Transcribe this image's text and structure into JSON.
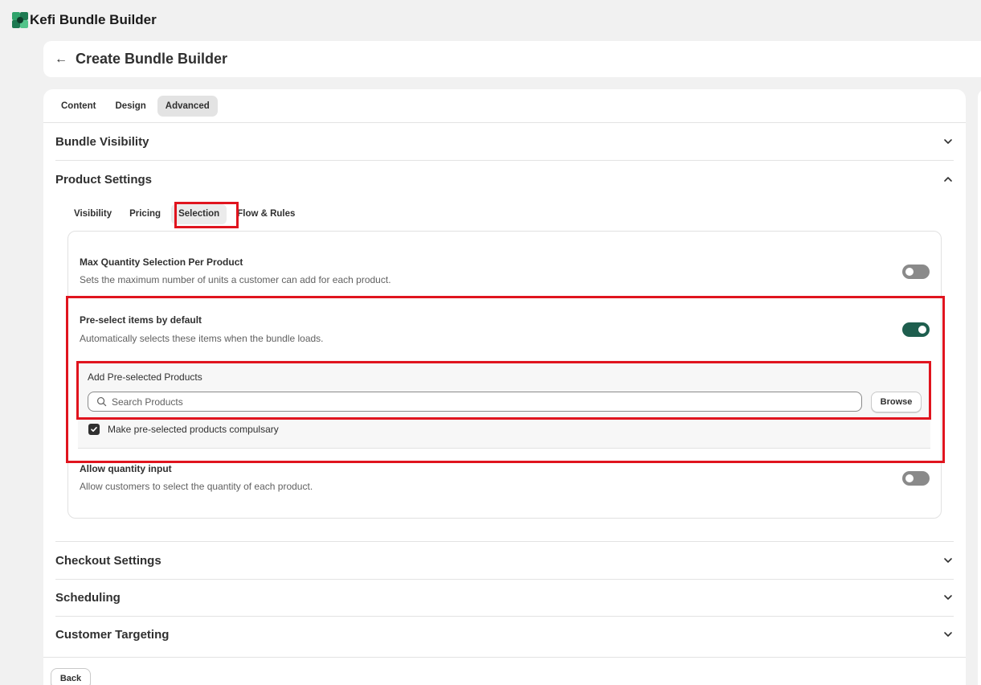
{
  "app": {
    "title": "Kefi Bundle Builder"
  },
  "header": {
    "page_title": "Create Bundle Builder"
  },
  "tabs": [
    {
      "label": "Content",
      "active": false
    },
    {
      "label": "Design",
      "active": false
    },
    {
      "label": "Advanced",
      "active": true
    }
  ],
  "sections": {
    "bundle_visibility": {
      "title": "Bundle Visibility",
      "expanded": false
    },
    "product_settings": {
      "title": "Product Settings",
      "expanded": true
    },
    "checkout_settings": {
      "title": "Checkout Settings",
      "expanded": false
    },
    "scheduling": {
      "title": "Scheduling",
      "expanded": false
    },
    "customer_targeting": {
      "title": "Customer Targeting",
      "expanded": false
    }
  },
  "product_tabs": [
    {
      "label": "Visibility",
      "active": false
    },
    {
      "label": "Pricing",
      "active": false
    },
    {
      "label": "Selection",
      "active": true
    },
    {
      "label": "Flow & Rules",
      "active": false
    }
  ],
  "settings": {
    "max_quantity": {
      "title": "Max Quantity Selection Per Product",
      "description": "Sets the maximum number of units a customer can add for each product.",
      "enabled": false
    },
    "preselect": {
      "title": "Pre-select items by default",
      "description": "Automatically selects these items when the bundle loads.",
      "enabled": true,
      "panel_label": "Add Pre-selected Products",
      "search_placeholder": "Search Products",
      "browse_label": "Browse",
      "compulsory_label": "Make pre-selected products compulsary",
      "compulsory_checked": true
    },
    "quantity_input": {
      "title": "Allow quantity input",
      "description": "Allow customers to select the quantity of each product.",
      "enabled": false
    }
  },
  "footer": {
    "back_label": "Back"
  },
  "colors": {
    "accent_green": "#1e5e4e",
    "highlight_red": "#e0141e",
    "toggle_off": "#8a8a8a"
  }
}
